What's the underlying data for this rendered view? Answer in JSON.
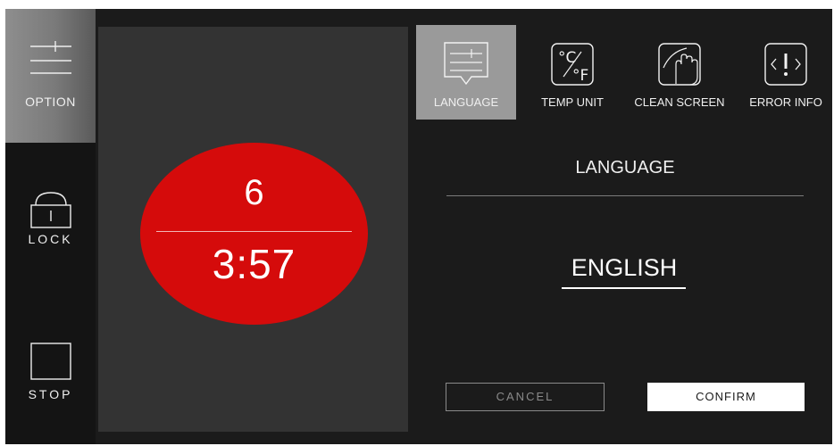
{
  "sidebar": {
    "option_label": "OPTION",
    "lock_label": "LOCK",
    "stop_label": "STOP"
  },
  "timer": {
    "top_value": "6",
    "time_remaining": "3:57"
  },
  "tabs": [
    {
      "label": "LANGUAGE",
      "icon": "language-icon",
      "active": true
    },
    {
      "label": "TEMP UNIT",
      "icon": "temp-unit-icon",
      "active": false
    },
    {
      "label": "CLEAN SCREEN",
      "icon": "clean-screen-icon",
      "active": false
    },
    {
      "label": "ERROR INFO",
      "icon": "error-info-icon",
      "active": false
    }
  ],
  "language": {
    "heading": "LANGUAGE",
    "selected": "ENGLISH"
  },
  "actions": {
    "cancel_label": "CANCEL",
    "confirm_label": "CONFIRM"
  },
  "colors": {
    "background": "#1b1b1b",
    "sidebar": "#141414",
    "panel": "#333333",
    "timer_red": "#d50b0b",
    "active_tab": "#9a9a9a",
    "text": "#ffffff"
  }
}
